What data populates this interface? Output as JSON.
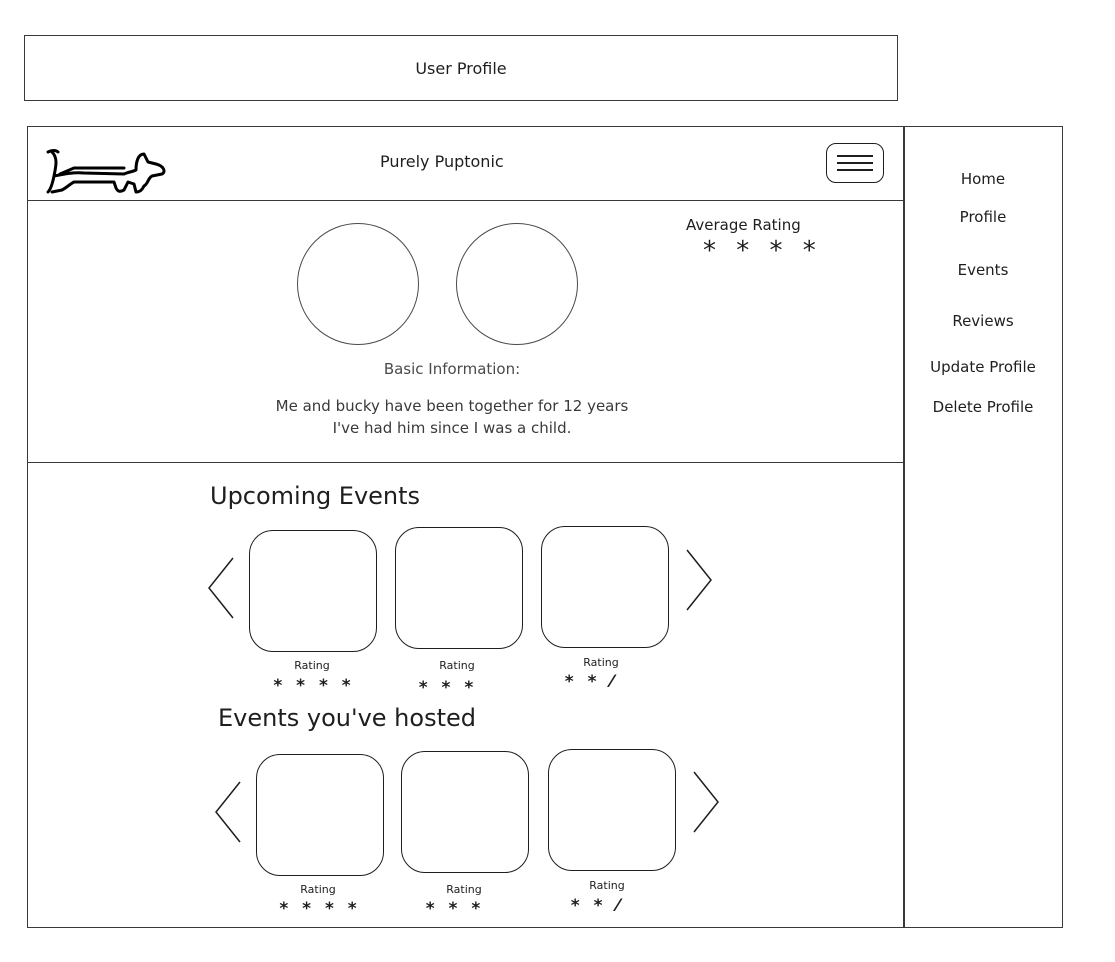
{
  "page_title": "User Profile",
  "app": {
    "name": "Purely Puptonic"
  },
  "sidebar": {
    "items": [
      {
        "label": "Home"
      },
      {
        "label": "Profile"
      },
      {
        "label": "Events"
      },
      {
        "label": "Reviews"
      },
      {
        "label": "Update Profile"
      },
      {
        "label": "Delete Profile"
      }
    ]
  },
  "profile": {
    "average_rating_label": "Average Rating",
    "average_rating_stars": "* * * *",
    "basic_info_title": "Basic Information:",
    "bio_lines": [
      "Me and bucky have been together for 12 years",
      "I've had him since I was a child."
    ]
  },
  "upcoming": {
    "title": "Upcoming Events",
    "cards": [
      {
        "rating_label": "Rating",
        "stars": "* * * *"
      },
      {
        "rating_label": "Rating",
        "stars": "* * *"
      },
      {
        "rating_label": "Rating",
        "stars": "* * ⁄"
      }
    ]
  },
  "hosted": {
    "title": "Events you've hosted",
    "cards": [
      {
        "rating_label": "Rating",
        "stars": "* * * *"
      },
      {
        "rating_label": "Rating",
        "stars": "* * *"
      },
      {
        "rating_label": "Rating",
        "stars": "* * ⁄"
      }
    ]
  },
  "icons": {
    "logo": "dog-icon",
    "menu": "hamburger-menu-icon",
    "prev": "chevron-left-icon",
    "next": "chevron-right-icon"
  }
}
